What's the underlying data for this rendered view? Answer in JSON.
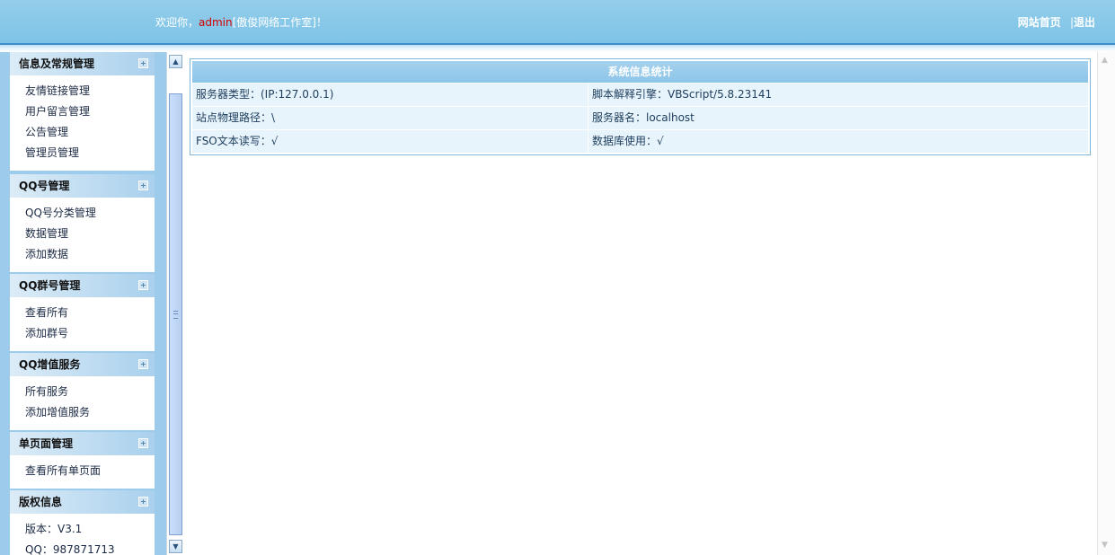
{
  "header": {
    "welcome_prefix": "欢迎你，",
    "username": "admin",
    "org": "[傲俊网络工作室]",
    "welcome_suffix": "！",
    "link_home": "网站首页",
    "separator": "|",
    "link_logout": "退出"
  },
  "sidebar": {
    "groups": [
      {
        "title": "信息及常规管理",
        "items": [
          "友情链接管理",
          "用户留言管理",
          "公告管理",
          "管理员管理"
        ]
      },
      {
        "title": "QQ号管理",
        "items": [
          "QQ号分类管理",
          "数据管理",
          "添加数据"
        ]
      },
      {
        "title": "QQ群号管理",
        "items": [
          "查看所有",
          "添加群号"
        ]
      },
      {
        "title": "QQ增值服务",
        "items": [
          "所有服务",
          "添加增值服务"
        ]
      },
      {
        "title": "单页面管理",
        "items": [
          "查看所有单页面"
        ]
      },
      {
        "title": "版权信息",
        "items": [
          "版本：V3.1",
          "QQ：987871713"
        ]
      }
    ]
  },
  "sysinfo": {
    "title": "系统信息统计",
    "rows": [
      [
        "服务器类型：(IP:127.0.0.1)",
        "脚本解释引擎：VBScript/5.8.23141"
      ],
      [
        "站点物理路径：\\",
        "服务器名：localhost"
      ],
      [
        "FSO文本读写：√",
        "数据库使用：√"
      ]
    ]
  },
  "colors": {
    "header": "#7ec3e8",
    "sidebar_bg": "#9ccbeb",
    "username": "#d40000",
    "table_cell": "#e8f4fc"
  }
}
